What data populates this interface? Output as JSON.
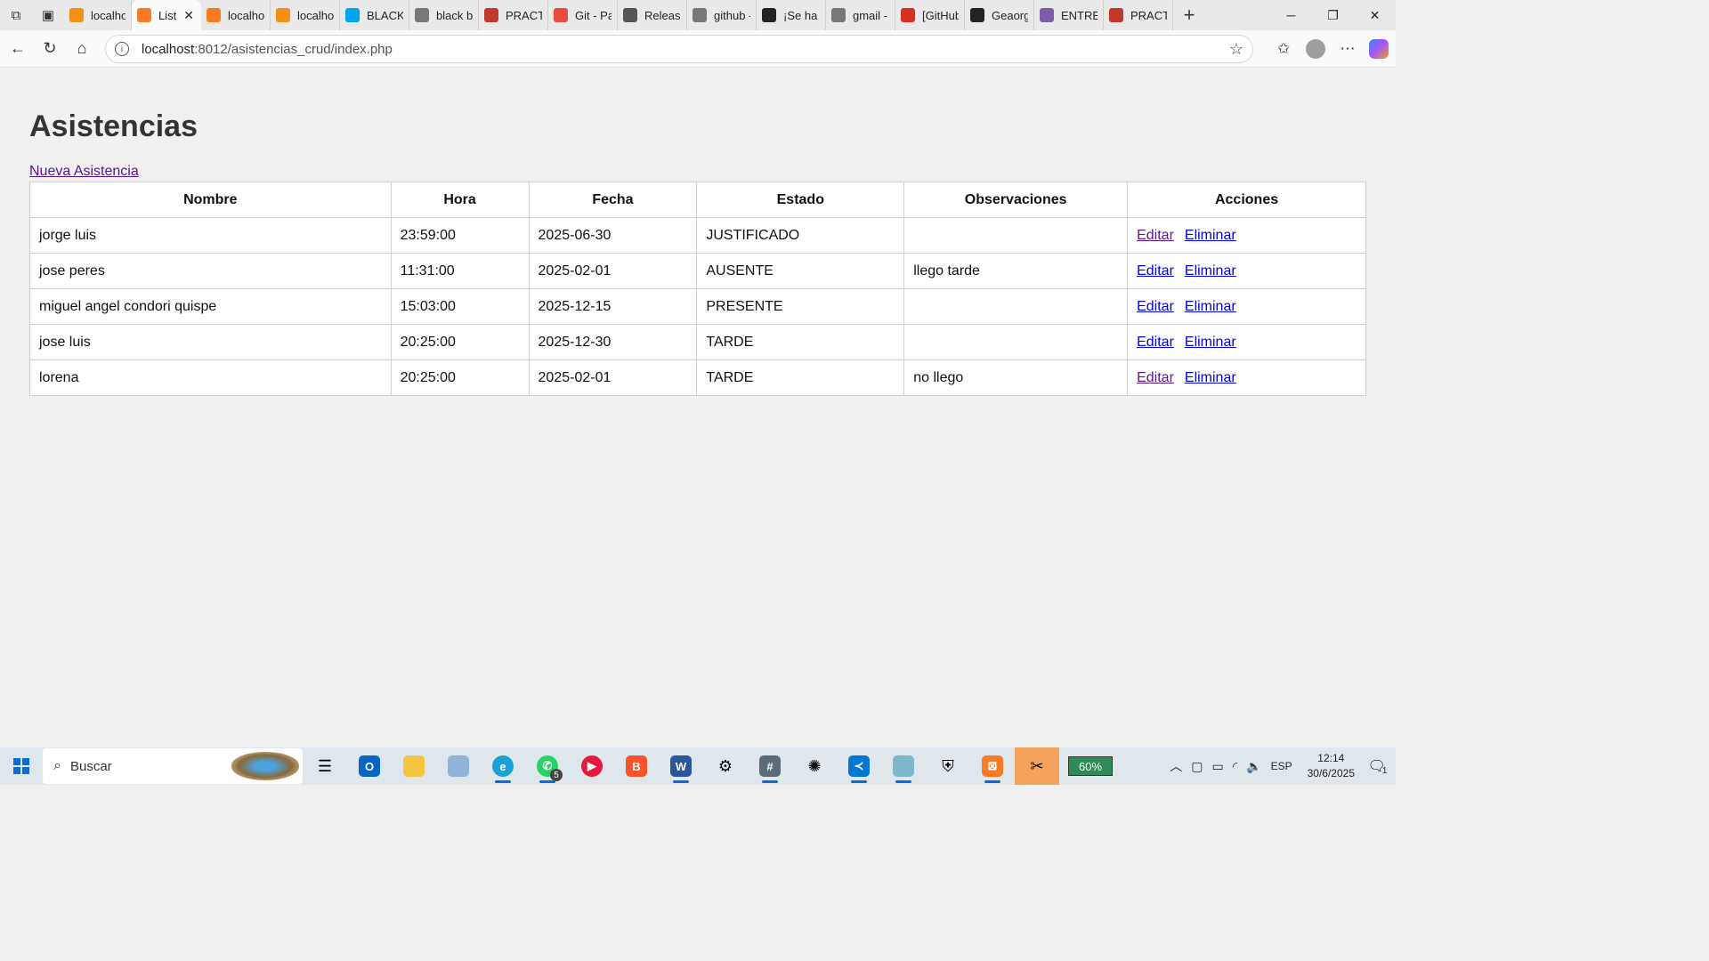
{
  "browser": {
    "tabs": [
      {
        "label": "localhos",
        "icon": "phpmyadmin-icon",
        "color": "#f29111"
      },
      {
        "label": "List",
        "icon": "xampp-icon",
        "color": "#fb7a24",
        "active": true
      },
      {
        "label": "localhos",
        "icon": "xampp-icon",
        "color": "#fb7a24"
      },
      {
        "label": "localhos",
        "icon": "phpmyadmin-icon",
        "color": "#f29111"
      },
      {
        "label": "BLACKB",
        "icon": "microsoft-icon",
        "color": "#00a4ef"
      },
      {
        "label": "black bo",
        "icon": "search-icon",
        "color": "#777777"
      },
      {
        "label": "PRACTIC",
        "icon": "pdf-icon",
        "color": "#c0392b"
      },
      {
        "label": "Git - Pa",
        "icon": "git-icon",
        "color": "#e74c3c"
      },
      {
        "label": "Release",
        "icon": "globe-icon",
        "color": "#555555"
      },
      {
        "label": "github -",
        "icon": "search-icon",
        "color": "#777777"
      },
      {
        "label": "¡Se ha e",
        "icon": "github-icon",
        "color": "#222222"
      },
      {
        "label": "gmail - ",
        "icon": "search-icon",
        "color": "#777777"
      },
      {
        "label": "[GitHub",
        "icon": "gmail-icon",
        "color": "#d93025"
      },
      {
        "label": "Geaorge",
        "icon": "github-icon",
        "color": "#222222"
      },
      {
        "label": "ENTREG",
        "icon": "forms-icon",
        "color": "#7b5ea7"
      },
      {
        "label": "PRACTIC",
        "icon": "pdf-icon",
        "color": "#c0392b"
      }
    ],
    "url_host": "localhost",
    "url_rest": ":8012/asistencias_crud/index.php"
  },
  "page": {
    "title": "Asistencias",
    "new_link": "Nueva Asistencia",
    "columns": [
      "Nombre",
      "Hora",
      "Fecha",
      "Estado",
      "Observaciones",
      "Acciones"
    ],
    "rows": [
      {
        "nombre": "jorge luis",
        "hora": "23:59:00",
        "fecha": "2025-06-30",
        "estado": "JUSTIFICADO",
        "obs": "",
        "edit": "Editar",
        "delete": "Eliminar"
      },
      {
        "nombre": "jose peres",
        "hora": "11:31:00",
        "fecha": "2025-02-01",
        "estado": "AUSENTE",
        "obs": "llego tarde",
        "edit": "Editar",
        "delete": "Eliminar"
      },
      {
        "nombre": "miguel angel condori quispe",
        "hora": "15:03:00",
        "fecha": "2025-12-15",
        "estado": "PRESENTE",
        "obs": "",
        "edit": "Editar",
        "delete": "Eliminar"
      },
      {
        "nombre": "jose luis",
        "hora": "20:25:00",
        "fecha": "2025-12-30",
        "estado": "TARDE",
        "obs": "",
        "edit": "Editar",
        "delete": "Eliminar"
      },
      {
        "nombre": "lorena",
        "hora": "20:25:00",
        "fecha": "2025-02-01",
        "estado": "TARDE",
        "obs": "no llego",
        "edit": "Editar",
        "delete": "Eliminar"
      }
    ]
  },
  "taskbar": {
    "search_placeholder": "Buscar",
    "battery": "60%",
    "language": "ESP",
    "time": "12:14",
    "date": "30/6/2025",
    "whatsapp_badge": "5",
    "notifications": "1"
  }
}
